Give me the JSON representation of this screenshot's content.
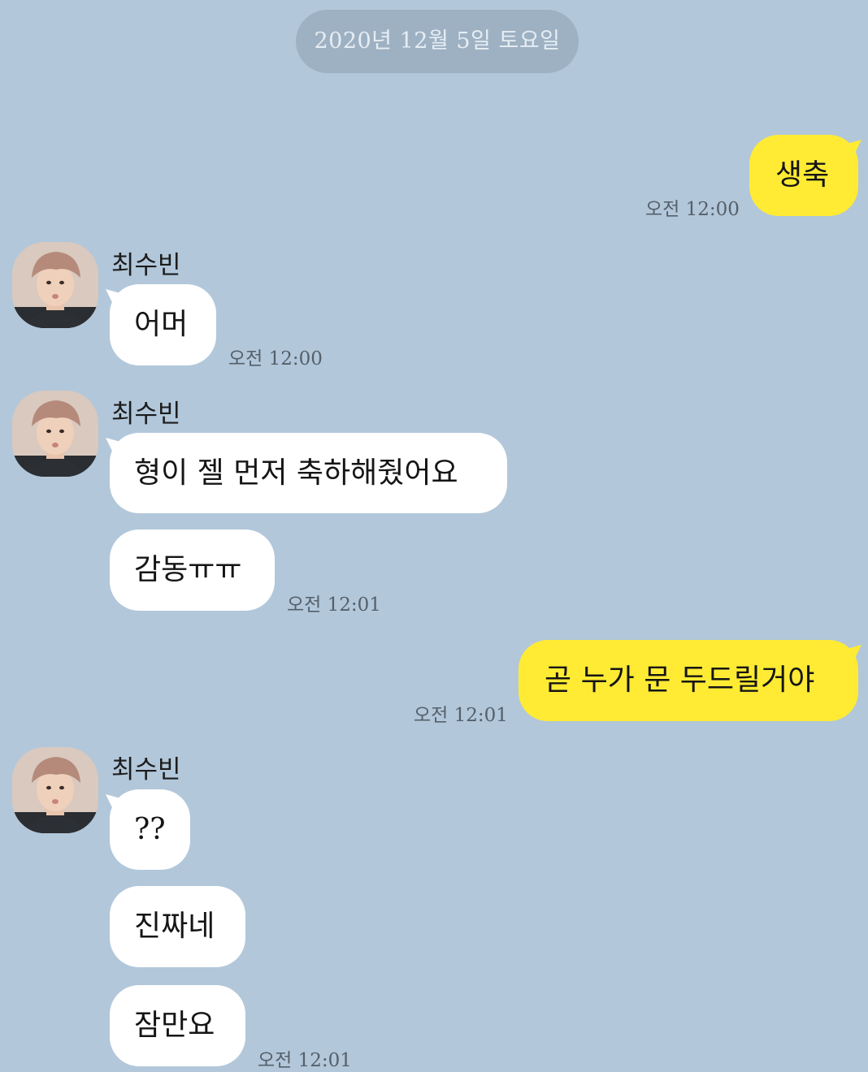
{
  "chat": {
    "date": "2020년 12월 5일 토요일",
    "sender_name": "최수빈",
    "messages": [
      {
        "dir": "out",
        "text": "생축",
        "time": "오전 12:00"
      },
      {
        "dir": "in",
        "text": "어머",
        "time": "오전 12:00"
      },
      {
        "dir": "in",
        "text": "형이 젤 먼저 축하해줬어요"
      },
      {
        "dir": "in",
        "text": "감동ㅠㅠ",
        "time": "오전 12:01"
      },
      {
        "dir": "out",
        "text": "곧 누가 문 두드릴거야",
        "time": "오전 12:01"
      },
      {
        "dir": "in",
        "text": "??"
      },
      {
        "dir": "in",
        "text": "진짜네"
      },
      {
        "dir": "in",
        "text": "잠만요",
        "time": "오전 12:01"
      }
    ]
  },
  "colors": {
    "background": "#b2c7da",
    "outgoing_bubble": "#ffeb33",
    "incoming_bubble": "#ffffff",
    "date_pill": "#9eb1c3"
  },
  "icons": {
    "avatar": "profile-photo-icon"
  }
}
